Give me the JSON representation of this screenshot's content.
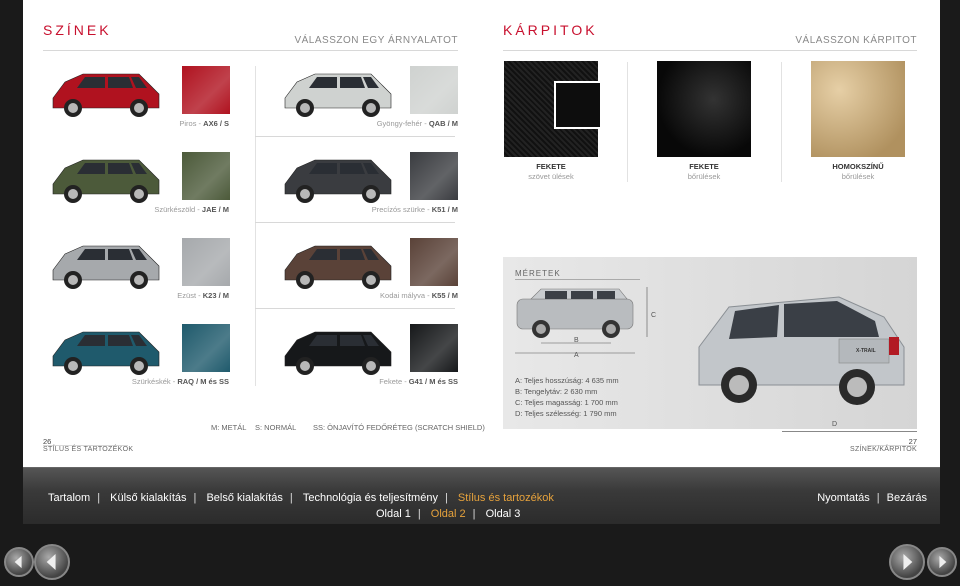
{
  "colors_section": {
    "title": "SZÍNEK",
    "subtitle": "VÁLASSZON EGY ÁRNYALATOT"
  },
  "upholstery_section": {
    "title": "KÁRPITOK",
    "subtitle": "VÁLASSZON KÁRPITOT"
  },
  "colors": [
    {
      "name": "Piros - ",
      "code": "AX6 / S",
      "hex": "#b0121f"
    },
    {
      "name": "Gyöngy-fehér - ",
      "code": "QAB / M",
      "hex": "#cfd2d0"
    },
    {
      "name": "Szürkészöld - ",
      "code": "JAE / M",
      "hex": "#4c5a3a"
    },
    {
      "name": "Precízós szürke - ",
      "code": "K51 / M",
      "hex": "#3a3c40"
    },
    {
      "name": "Ezüst - ",
      "code": "K23 / M",
      "hex": "#a6a9ac"
    },
    {
      "name": "Kodai mályva - ",
      "code": "K55 / M",
      "hex": "#5a4238"
    },
    {
      "name": "Szürkéskék - ",
      "code": "RAQ / M és SS",
      "hex": "#1f5a6c"
    },
    {
      "name": "Fekete - ",
      "code": "G41 / M és SS",
      "hex": "#16181a"
    }
  ],
  "legend": {
    "m": "M: METÁL",
    "s": "S: NORMÁL",
    "ss": "SS: ÖNJAVÍTÓ FEDŐRÉTEG (SCRATCH SHIELD)"
  },
  "upholstery": [
    {
      "name": "FEKETE",
      "desc": "szövet ülések",
      "hex": "#1c1c1c"
    },
    {
      "name": "FEKETE",
      "desc": "bőrülések",
      "hex": "#111111"
    },
    {
      "name": "HOMOKSZÍNŰ",
      "desc": "bőrülések",
      "hex": "#c9ad84"
    }
  ],
  "dimensions": {
    "title": "MÉRETEK",
    "labels": {
      "a": "A",
      "b": "B",
      "c": "C",
      "d": "D"
    },
    "specs": [
      "A: Teljes hosszúság: 4 635 mm",
      "B: Tengelytáv: 2 630 mm",
      "C: Teljes magasság: 1 700 mm",
      "D: Teljes szélesség: 1 790 mm"
    ],
    "badge": "X-TRAIL"
  },
  "page_left": {
    "number": "26",
    "name": "STÍLUS ÉS TARTOZÉKOK"
  },
  "page_right": {
    "number": "27",
    "name": "SZÍNEK/KÁRPITOK"
  },
  "nav": {
    "links": [
      "Tartalom",
      "Külső kialakítás",
      "Belső kialakítás",
      "Technológia és teljesítmény",
      "Stílus és tartozékok"
    ],
    "separator": "|",
    "right": {
      "print": "Nyomtatás",
      "close": "Bezárás"
    },
    "pages": [
      "Oldal 1",
      "Oldal 2",
      "Oldal 3"
    ]
  }
}
